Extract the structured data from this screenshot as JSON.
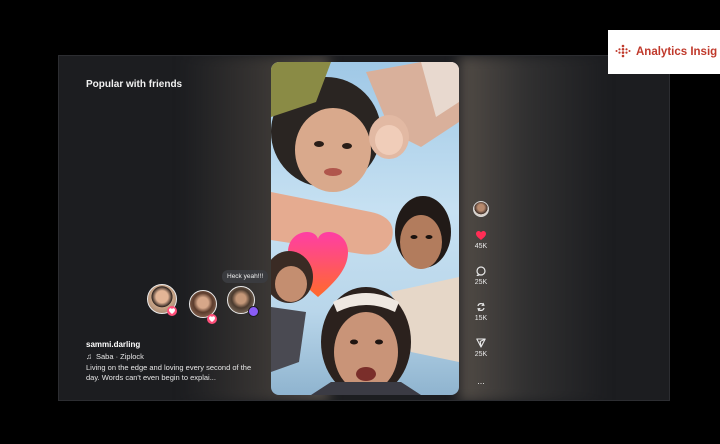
{
  "section": {
    "title": "Popular with friends"
  },
  "post": {
    "username": "sammi.darling",
    "music": "Saba · Ziplock",
    "caption": "Living on the edge and loving every second of the day. Words can't even begin to explai..."
  },
  "friends": {
    "comment": "Heck yeah!!!"
  },
  "actions": {
    "likes": "45K",
    "comments": "25K",
    "reposts": "15K",
    "shares": "25K",
    "more": "..."
  },
  "brand": {
    "name": "Analytics Insig"
  },
  "colors": {
    "like_red": "#ff2d55",
    "brand_red": "#c0392b",
    "reply_purple": "#8a5cf6"
  }
}
